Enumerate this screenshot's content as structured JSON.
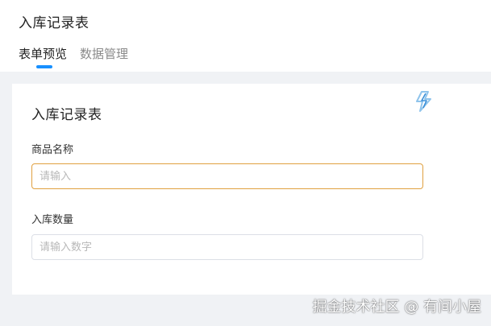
{
  "header": {
    "title": "入库记录表"
  },
  "tabs": [
    {
      "label": "表单预览",
      "active": true
    },
    {
      "label": "数据管理",
      "active": false
    }
  ],
  "form": {
    "title": "入库记录表",
    "fields": [
      {
        "label": "商品名称",
        "placeholder": "请输入",
        "value": ""
      },
      {
        "label": "入库数量",
        "placeholder": "请输入数字",
        "value": ""
      }
    ]
  },
  "icons": {
    "bolt": "lightning-bolt-icon"
  },
  "colors": {
    "accent": "#1890ff",
    "focus_border": "#e0a040",
    "background_gray": "#f0f2f5"
  },
  "watermark": {
    "text": "掘金技术社区 @ 有间小屋"
  }
}
